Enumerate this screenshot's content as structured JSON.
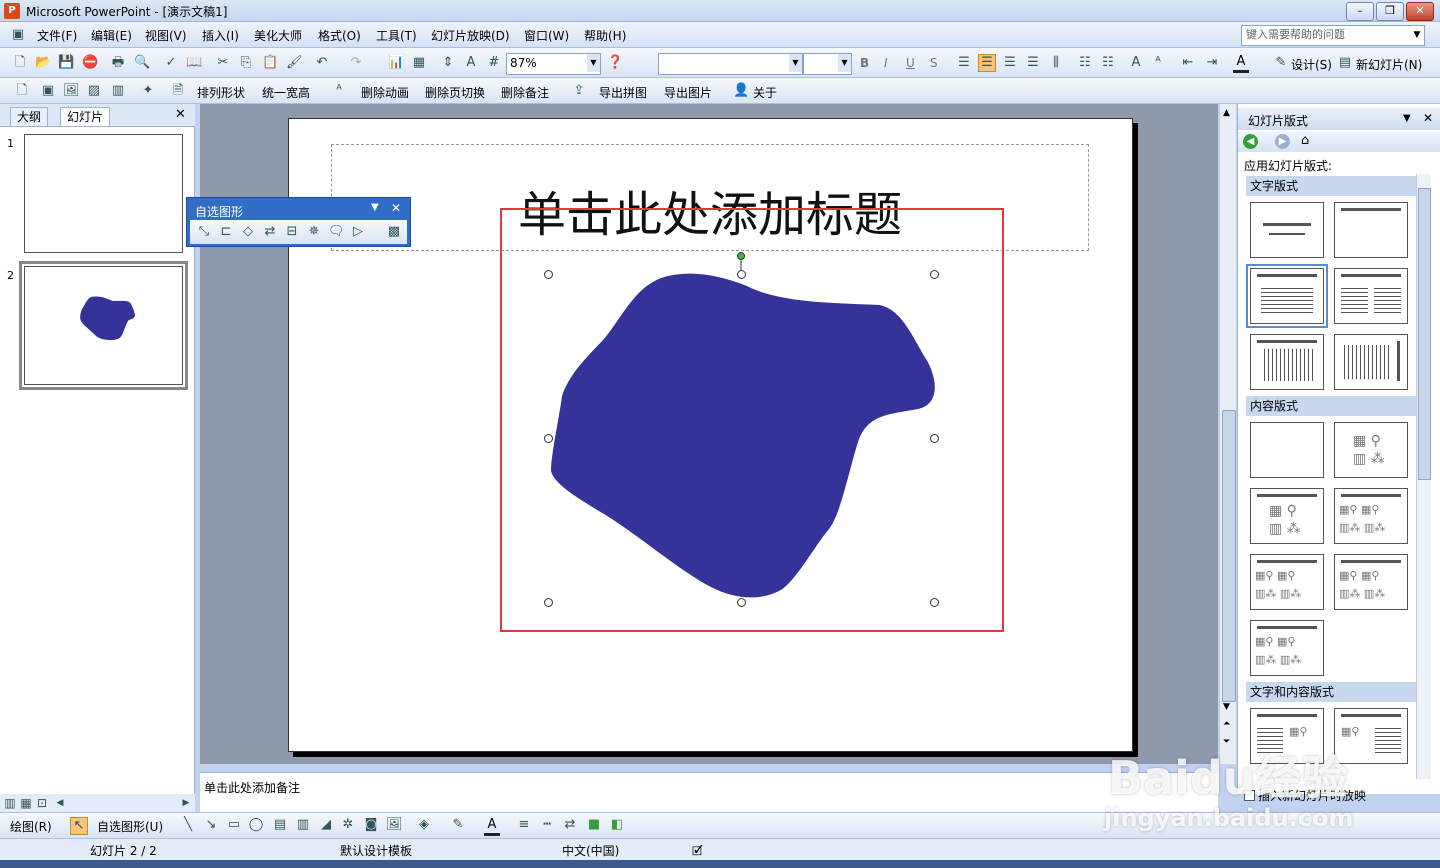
{
  "window": {
    "title": "Microsoft PowerPoint - [演示文稿1]",
    "app_icon": "powerpoint-icon"
  },
  "menubar": {
    "items": [
      "文件(F)",
      "编辑(E)",
      "视图(V)",
      "插入(I)",
      "美化大师",
      "格式(O)",
      "工具(T)",
      "幻灯片放映(D)",
      "窗口(W)",
      "帮助(H)"
    ],
    "help_placeholder": "键入需要帮助的问题"
  },
  "toolbar1": {
    "zoom": "87%",
    "font_name": "",
    "font_size": "",
    "bold": "B",
    "italic": "I",
    "underline": "U",
    "shadow": "S",
    "design_label": "设计(S)",
    "new_slide_label": "新幻灯片(N)"
  },
  "toolbar2": {
    "arrange_label": "排列形状",
    "unify_height_label": "统一宽高",
    "remove_anim_label": "删除动画",
    "remove_transition_label": "删除页切换",
    "remove_notes_label": "删除备注",
    "export_tiles_label": "导出拼图",
    "export_image_label": "导出图片",
    "about_label": "关于"
  },
  "leftpane": {
    "tab_outline": "大纲",
    "tab_slides": "幻灯片",
    "slides": [
      {
        "number": "1"
      },
      {
        "number": "2"
      }
    ]
  },
  "slide": {
    "title_placeholder": "单击此处添加标题",
    "shape_color": "#343399",
    "selection_color": "#e03a3a"
  },
  "float_toolbar": {
    "title": "自选图形"
  },
  "taskpane": {
    "title": "幻灯片版式",
    "apply_label": "应用幻灯片版式:",
    "section_text": "文字版式",
    "section_content": "内容版式",
    "section_text_content": "文字和内容版式",
    "checkbox_label": "插入新幻灯片时放映"
  },
  "notes": {
    "placeholder": "单击此处添加备注"
  },
  "drawing_toolbar": {
    "draw_label": "绘图(R)",
    "autoshapes_label": "自选图形(U)"
  },
  "statusbar": {
    "slide_position": "幻灯片 2 / 2",
    "template": "默认设计模板",
    "language": "中文(中国)"
  },
  "watermark": {
    "logo": "Baidu经验",
    "url": "jingyan.baidu.com"
  }
}
